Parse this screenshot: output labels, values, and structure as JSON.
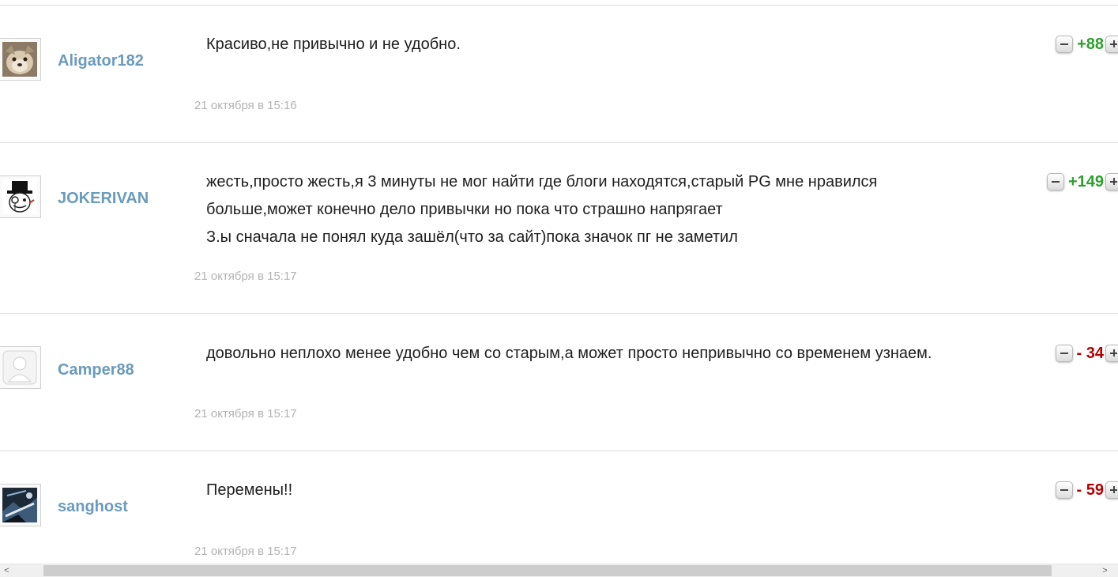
{
  "comments": [
    {
      "username": "Aligator182",
      "avatar_icon": "dog-avatar-icon",
      "lines": [
        "Красиво,не привычно и не удобно."
      ],
      "date": "21 октября в 15:16",
      "score": "88",
      "score_sign": "+",
      "score_color": "#2ca02c"
    },
    {
      "username": "JOKERIVAN",
      "avatar_icon": "top-hat-monocle-avatar-icon",
      "lines": [
        "жесть,просто жесть,я 3 минуты не мог найти где блоги находятся,старый PG мне нравился",
        "больше,может конечно дело привычки но пока что страшно напрягает",
        "З.ы сначала не понял куда зашёл(что за сайт)пока значок пг не заметил"
      ],
      "date": "21 октября в 15:17",
      "score": "149",
      "score_sign": "+",
      "score_color": "#2ca02c"
    },
    {
      "username": "Camper88",
      "avatar_icon": "default-user-avatar-icon",
      "lines": [
        "довольно неплохо менее удобно чем со старым,а может просто непривычно со временем узнаем."
      ],
      "date": "21 октября в 15:17",
      "score": "34",
      "score_sign": "-",
      "score_color": "#b30000"
    },
    {
      "username": "sanghost",
      "avatar_icon": "game-scene-avatar-icon",
      "lines": [
        "Перемены!!"
      ],
      "date": "21 октября в 15:17",
      "score": "59",
      "score_sign": "-",
      "score_color": "#b30000"
    }
  ],
  "scrollbar": {
    "left_arrow": "<",
    "right_arrow": ">"
  }
}
